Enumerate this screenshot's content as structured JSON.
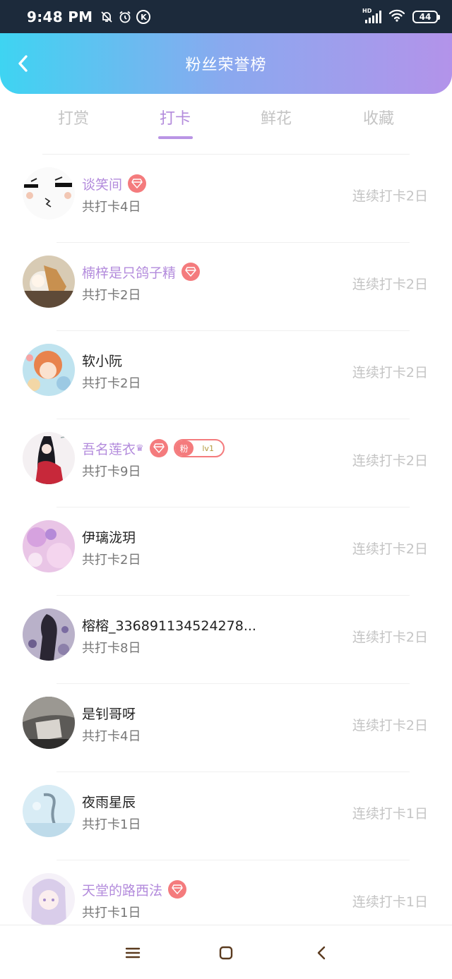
{
  "status_bar": {
    "time": "9:48 PM",
    "network": "HD",
    "battery": "44"
  },
  "header": {
    "title": "粉丝荣誉榜"
  },
  "tabs": [
    {
      "label": "打赏",
      "active": false
    },
    {
      "label": "打卡",
      "active": true
    },
    {
      "label": "鲜花",
      "active": false
    },
    {
      "label": "收藏",
      "active": false
    }
  ],
  "fans": [
    {
      "name": "谈笑间",
      "vip": true,
      "total": "共打卡4日",
      "streak": "连续打卡2日"
    },
    {
      "name": "楠梓是只鸽子精",
      "vip": true,
      "total": "共打卡2日",
      "streak": "连续打卡2日"
    },
    {
      "name": "软小阮",
      "vip": false,
      "total": "共打卡2日",
      "streak": "连续打卡2日"
    },
    {
      "name": "吾名莲衣",
      "vip": true,
      "fan_label": "粉",
      "fan_level": "lv1",
      "total": "共打卡9日",
      "streak": "连续打卡2日"
    },
    {
      "name": "伊璃泷玥",
      "vip": false,
      "total": "共打卡2日",
      "streak": "连续打卡2日"
    },
    {
      "name": "榕榕_336891134524278...",
      "vip": false,
      "total": "共打卡8日",
      "streak": "连续打卡2日"
    },
    {
      "name": "是钊哥呀",
      "vip": false,
      "total": "共打卡4日",
      "streak": "连续打卡2日"
    },
    {
      "name": "夜雨星辰",
      "vip": false,
      "total": "共打卡1日",
      "streak": "连续打卡1日"
    },
    {
      "name": "天堂的路西法",
      "vip": true,
      "total": "共打卡1日",
      "streak": "连续打卡1日"
    }
  ],
  "colors": {
    "accent": "#b38bdc",
    "badge": "#f47b7d",
    "header_start": "#3ed4f2",
    "header_end": "#b393ea"
  }
}
